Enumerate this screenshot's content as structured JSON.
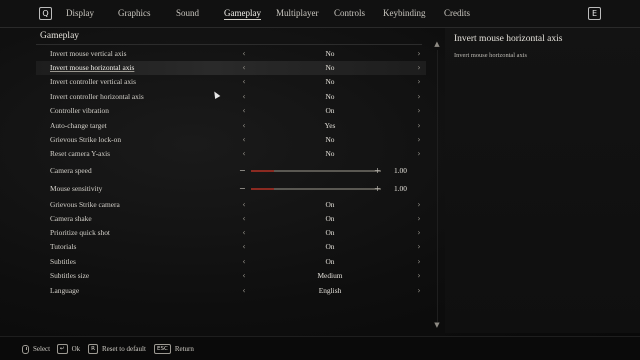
{
  "topbar": {
    "left_key": "Q",
    "right_key": "E",
    "tabs": [
      {
        "label": "Display"
      },
      {
        "label": "Graphics"
      },
      {
        "label": "Sound"
      },
      {
        "label": "Gameplay",
        "active": true
      },
      {
        "label": "Multiplayer"
      },
      {
        "label": "Controls"
      },
      {
        "label": "Keybinding"
      },
      {
        "label": "Credits"
      }
    ]
  },
  "section": {
    "title": "Gameplay"
  },
  "settings": [
    {
      "label": "Invert mouse vertical axis",
      "value": "No"
    },
    {
      "label": "Invert mouse horizontal axis",
      "value": "No",
      "selected": true
    },
    {
      "label": "Invert controller vertical axis",
      "value": "No"
    },
    {
      "label": "Invert controller horizontal axis",
      "value": "No"
    },
    {
      "label": "Controller vibration",
      "value": "On"
    },
    {
      "label": "Auto-change target",
      "value": "Yes"
    },
    {
      "label": "Grievous Strike lock-on",
      "value": "No"
    },
    {
      "label": "Reset camera Y-axis",
      "value": "No"
    },
    {
      "label": "Camera speed",
      "value": "1.00",
      "type": "slider",
      "level": 0.18
    },
    {
      "label": "Mouse sensitivity",
      "value": "1.00",
      "type": "slider",
      "level": 0.18
    },
    {
      "label": "Grievous Strike camera",
      "value": "On"
    },
    {
      "label": "Camera shake",
      "value": "On"
    },
    {
      "label": "Prioritize quick shot",
      "value": "On"
    },
    {
      "label": "Tutorials",
      "value": "On"
    },
    {
      "label": "Subtitles",
      "value": "On"
    },
    {
      "label": "Subtitles size",
      "value": "Medium"
    },
    {
      "label": "Language",
      "value": "English"
    }
  ],
  "description": {
    "title": "Invert mouse horizontal axis",
    "body": "Invert mouse horizontal axis"
  },
  "footer": {
    "select_label": "Select",
    "ok_key": "↵",
    "ok_label": "Ok",
    "reset_key": "R",
    "reset_label": "Reset to default",
    "return_key": "ESC",
    "return_label": "Return"
  },
  "colors": {
    "slider_fill": "#8b2a21",
    "background": "#0c0c0c",
    "text": "#d6d3cc"
  }
}
